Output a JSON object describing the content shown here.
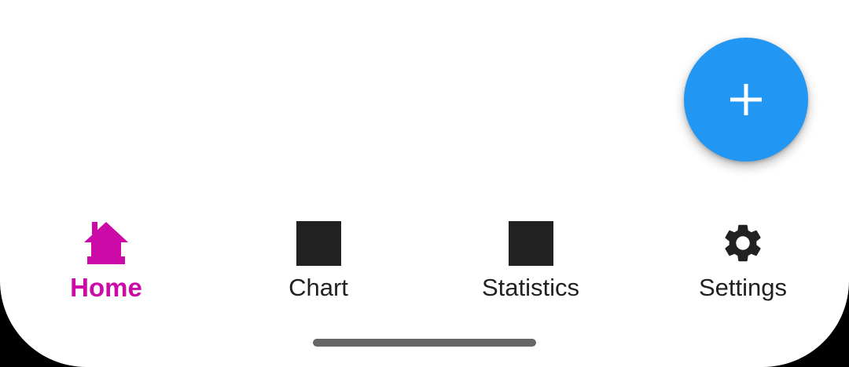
{
  "fab": {
    "icon": "plus-icon",
    "color": "#2196f3"
  },
  "nav": {
    "active_color": "#cc0aa8",
    "inactive_color": "#212121",
    "items": [
      {
        "label": "Home",
        "icon": "home-icon",
        "active": true
      },
      {
        "label": "Chart",
        "icon": "square-icon",
        "active": false
      },
      {
        "label": "Statistics",
        "icon": "square-icon",
        "active": false
      },
      {
        "label": "Settings",
        "icon": "gear-icon",
        "active": false
      }
    ]
  }
}
